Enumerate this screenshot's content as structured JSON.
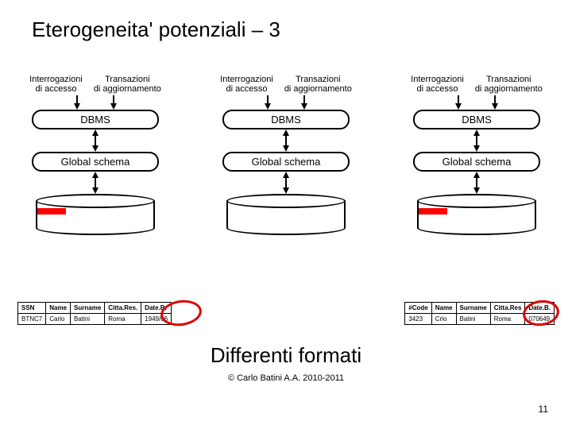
{
  "title": "Eterogeneita' potenziali – 3",
  "header": {
    "query_l1": "Interrogazioni",
    "query_l2": "di accesso",
    "trans_l1": "Transazioni",
    "trans_l2": "di aggiornamento"
  },
  "box": {
    "dbms": "DBMS",
    "schema": "Global schema"
  },
  "tableA": {
    "h1": "SSN",
    "h2": "Name",
    "h3": "Surname",
    "h4": "Citta.Res.",
    "h5": "Date.B.",
    "r1": "BTNC7",
    "r2": "Carlo",
    "r3": "Batini",
    "r4": "Roma",
    "r5": "1949/06"
  },
  "tableB": {
    "h1": "#Code",
    "h2": "Name",
    "h3": "Surname",
    "h4": "Citta.Res",
    "h5": "Date.B.",
    "r1": "3423",
    "r2": "Crlo",
    "r3": "Batini",
    "r4": "Roma",
    "r5": "070649"
  },
  "footer": {
    "big": "Differenti formati",
    "ref": "© Carlo Batini A.A. 2010-2011",
    "page": "11"
  }
}
